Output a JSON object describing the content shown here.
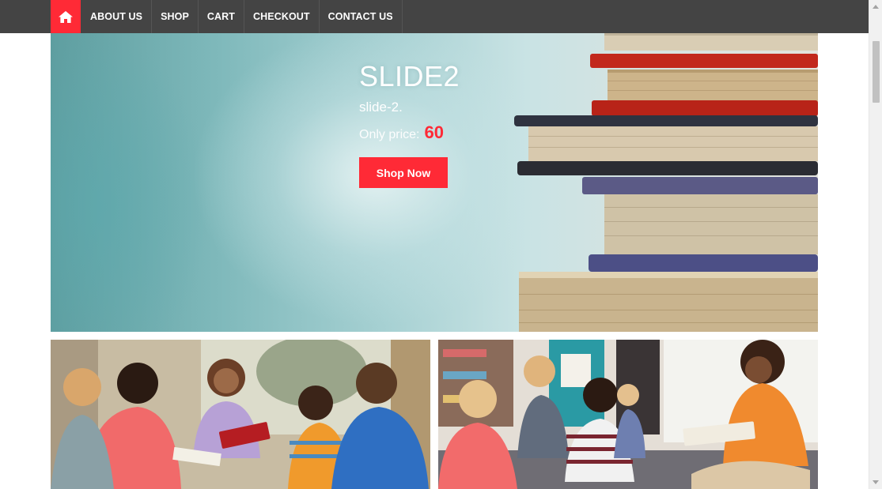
{
  "nav": {
    "home_icon": "home-icon",
    "items": [
      {
        "label": "ABOUT US"
      },
      {
        "label": "SHOP"
      },
      {
        "label": "CART"
      },
      {
        "label": "CHECKOUT"
      },
      {
        "label": "CONTACT US"
      }
    ]
  },
  "slider": {
    "title": "SLIDE2",
    "subtitle": "slide-2.",
    "price_label": "Only price:",
    "price": "60",
    "button_label": "Shop Now"
  },
  "colors": {
    "accent": "#ff2a36",
    "navbar": "#444444"
  }
}
